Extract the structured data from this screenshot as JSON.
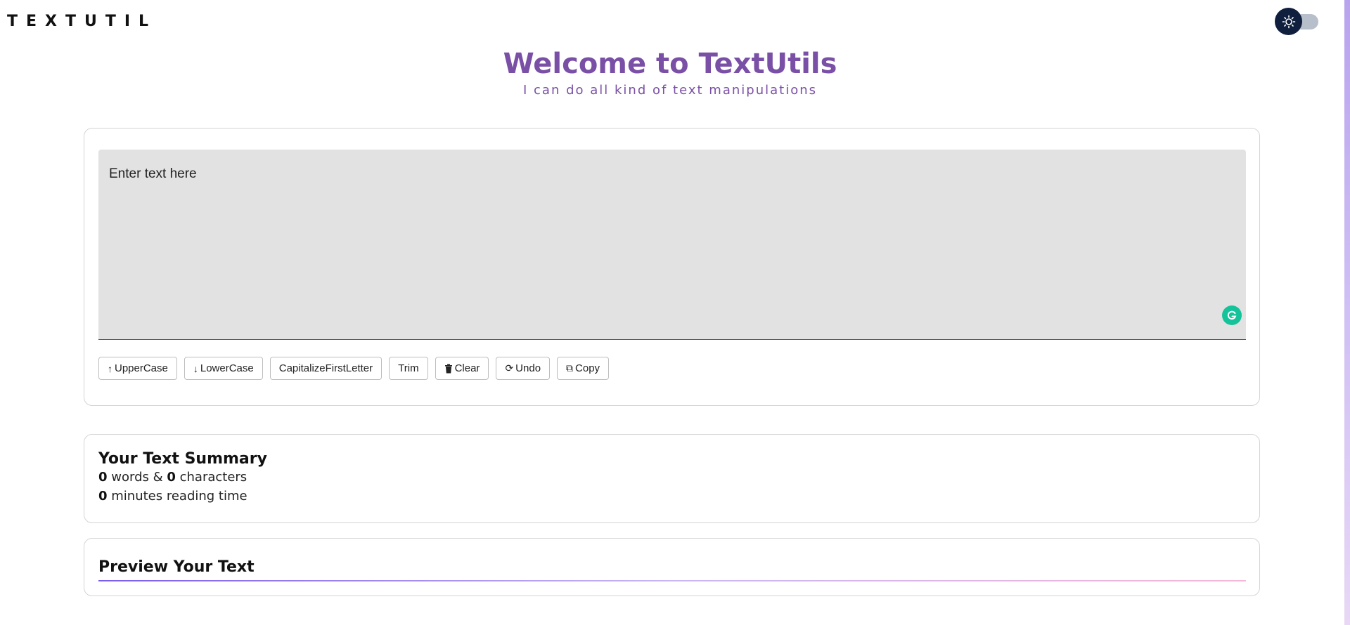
{
  "brand": "TEXTUTIL",
  "theme_toggle": {
    "icon": "sun-icon",
    "knob_color": "#0f1f3d",
    "track_color": "#b7bfcb"
  },
  "hero": {
    "title": "Welcome to TextUtils",
    "subtitle": "I can do all kind of text manipulations",
    "accent_color": "#7a4fa6"
  },
  "editor": {
    "placeholder": "Enter text here",
    "value": "",
    "buttons": [
      {
        "icon": "↑",
        "icon_name": "arrow-up-icon",
        "label": "UpperCase"
      },
      {
        "icon": "↓",
        "icon_name": "arrow-down-icon",
        "label": "LowerCase"
      },
      {
        "icon": "",
        "icon_name": "",
        "label": "CapitalizeFirstLetter"
      },
      {
        "icon": "",
        "icon_name": "",
        "label": "Trim"
      },
      {
        "icon": "🗑",
        "icon_name": "trash-icon",
        "label": "Clear"
      },
      {
        "icon": "⟳",
        "icon_name": "undo-icon",
        "label": "Undo"
      },
      {
        "icon": "⧉",
        "icon_name": "copy-icon",
        "label": "Copy"
      }
    ]
  },
  "summary": {
    "title": "Your Text Summary",
    "word_count": "0",
    "words_text": " words & ",
    "char_count": "0",
    "chars_text": " characters",
    "minutes": "0",
    "minutes_text": " minutes reading time"
  },
  "preview": {
    "title": "Preview Your Text"
  }
}
